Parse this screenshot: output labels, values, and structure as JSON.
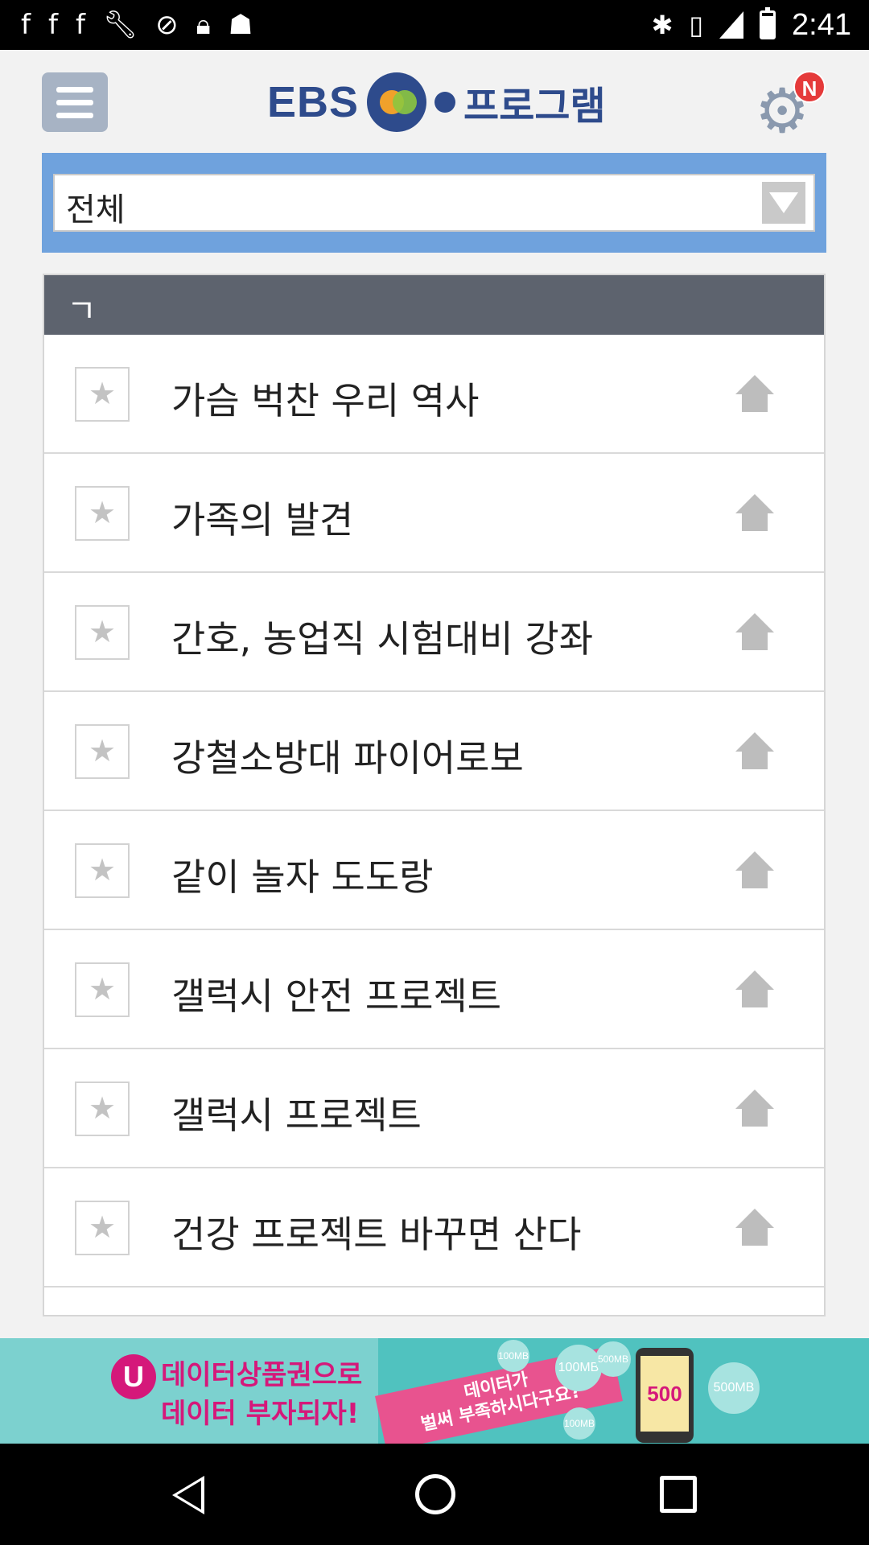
{
  "status_bar": {
    "time": "2:41",
    "left_icons": [
      "facebook-icon",
      "facebook-icon",
      "facebook-icon",
      "wrench-icon",
      "sync-icon",
      "lock-icon",
      "android-icon"
    ],
    "right_icons": [
      "bluetooth-icon",
      "vibrate-icon",
      "signal-icon",
      "battery-icon"
    ]
  },
  "header": {
    "logo_ebs": "EBS",
    "logo_program": "프로그램",
    "settings_badge": "N"
  },
  "filter": {
    "selected": "전체"
  },
  "list": {
    "section_label": "ㄱ",
    "items": [
      {
        "title": "가슴 벅찬 우리 역사"
      },
      {
        "title": "가족의 발견"
      },
      {
        "title": "간호, 농업직 시험대비 강좌"
      },
      {
        "title": "강철소방대 파이어로보"
      },
      {
        "title": "같이 놀자 도도랑"
      },
      {
        "title": "갤럭시 안전 프로젝트"
      },
      {
        "title": "갤럭시 프로젝트"
      },
      {
        "title": "건강 프로젝트 바꾸면 산다"
      }
    ]
  },
  "ad": {
    "brand_glyph": "U",
    "line1": "데이터상품권으로",
    "line2": "데이터 부자되자!",
    "ribbon_line1": "데이터가",
    "ribbon_line2": "벌써 부족하시다구요?",
    "phone_value": "500 MB",
    "bubble_1": "100MB",
    "bubble_2": "500MB",
    "bubble_3": "100MB",
    "bubble_4": "500MB",
    "bubble_5": "100MB"
  },
  "colors": {
    "header_blue": "#2e4b8c",
    "filter_bg": "#6fa2dd",
    "section_bg": "#5d636e",
    "badge_red": "#e53a3a",
    "ad_teal": "#50c2bf",
    "ad_magenta": "#d5187a"
  }
}
